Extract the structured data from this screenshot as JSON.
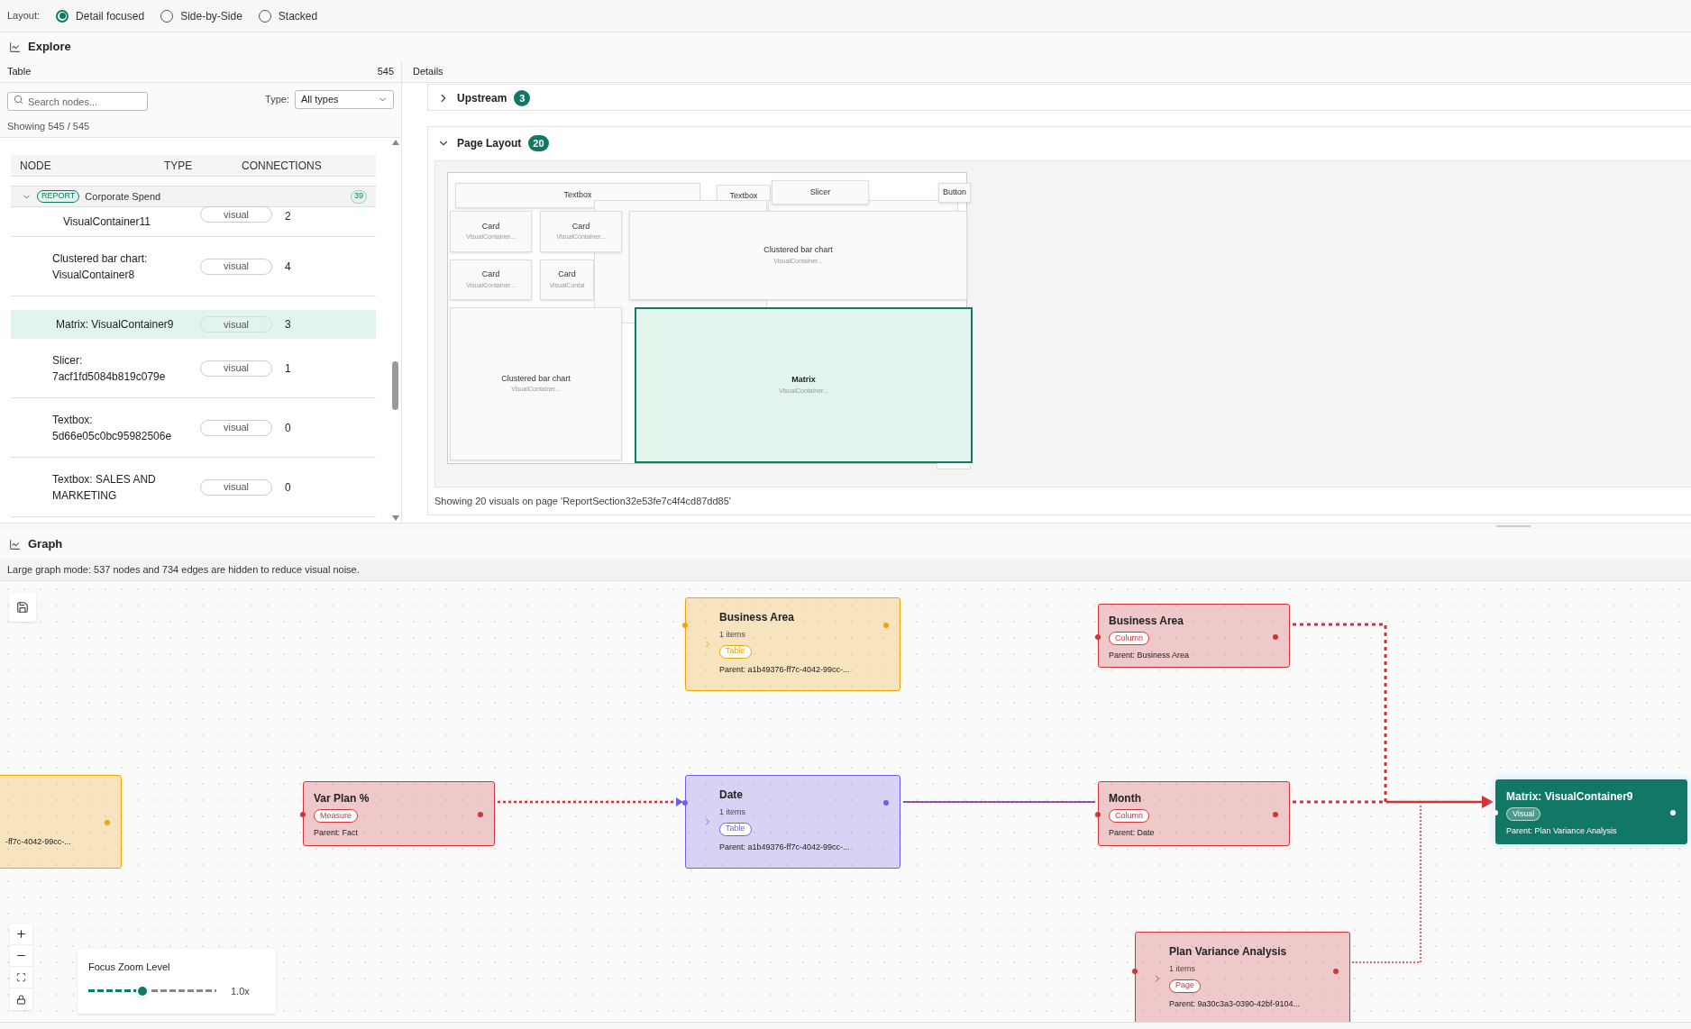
{
  "layout_bar": {
    "label": "Layout:",
    "options": [
      {
        "label": "Detail focused",
        "selected": true
      },
      {
        "label": "Side-by-Side",
        "selected": false
      },
      {
        "label": "Stacked",
        "selected": false
      }
    ]
  },
  "explore": {
    "title": "Explore",
    "table": {
      "title": "Table",
      "total": "545",
      "search": {
        "placeholder": "Search nodes..."
      },
      "type_label": "Type:",
      "type_value": "All types",
      "showing": "Showing 545 / 545",
      "columns": [
        "NODE",
        "TYPE",
        "CONNECTIONS"
      ],
      "group": {
        "badge": "REPORT",
        "name": "Corporate Spend",
        "count": "39",
        "expanded": true
      },
      "rows": [
        {
          "node": "VisualContainer11",
          "type": "visual",
          "connections": "2",
          "selected": false
        },
        {
          "node": "Clustered bar chart: VisualContainer8",
          "type": "visual",
          "connections": "4",
          "selected": false
        },
        {
          "node": "Matrix: VisualContainer9",
          "type": "visual",
          "connections": "3",
          "selected": true
        },
        {
          "node": "Slicer: 7acf1fd5084b819c079e",
          "type": "visual",
          "connections": "1",
          "selected": false
        },
        {
          "node": "Textbox: 5d66e05c0bc95982506e",
          "type": "visual",
          "connections": "0",
          "selected": false
        },
        {
          "node": "Textbox: SALES AND MARKETING",
          "type": "visual",
          "connections": "0",
          "selected": false
        }
      ]
    },
    "details": {
      "title": "Details",
      "sections": [
        {
          "title": "Upstream",
          "count": "3",
          "expanded": false
        },
        {
          "title": "Page Layout",
          "count": "20",
          "expanded": true
        }
      ],
      "visuals": [
        {
          "title": "Textbox",
          "selected": false
        },
        {
          "title": "Textbox",
          "selected": false
        },
        {
          "title": "Card",
          "subtitle": "VisualContai",
          "selected": false
        },
        {
          "title": "Slicer",
          "selected": false
        },
        {
          "title": "Button",
          "selected": false
        },
        {
          "title": "Card",
          "subtitle": "VisualContainer...",
          "selected": false
        },
        {
          "title": "Card",
          "subtitle": "VisualContainer...",
          "selected": false
        },
        {
          "title": "Card",
          "subtitle": "VisualContainer...",
          "selected": false
        },
        {
          "title": "Clustered bar chart",
          "subtitle": "VisualContainer...",
          "selected": false
        },
        {
          "title": "Clustered bar chart",
          "subtitle": "VisualContainer...",
          "selected": false
        },
        {
          "title": "Matrix",
          "subtitle": "VisualContainer...",
          "selected": true
        }
      ],
      "footer": "Showing 20 visuals on page 'ReportSection32e53fe7c4f4cd87dd85'"
    }
  },
  "graph": {
    "title": "Graph",
    "notice": "Large graph mode: 537 nodes and 734 edges are hidden to reduce visual noise.",
    "nodes": [
      {
        "title": "Business Area",
        "items": "1 items",
        "tag": "Table",
        "parent": "Parent: a1b49376-ff7c-4042-99cc-...",
        "color": "#f0a30a",
        "selected": false
      },
      {
        "title": "Business Area",
        "tag": "Column",
        "parent": "Parent: Business Area",
        "color": "#d13438",
        "selected": false
      },
      {
        "parent": "-ff7c-4042-99cc-...",
        "color": "#f0a30a",
        "selected": false
      },
      {
        "title": "Var Plan %",
        "tag": "Measure",
        "parent": "Parent: Fact",
        "color": "#d13438",
        "selected": false
      },
      {
        "title": "Date",
        "items": "1 items",
        "tag": "Table",
        "parent": "Parent: a1b49376-ff7c-4042-99cc-...",
        "color": "#7160e8",
        "selected": false
      },
      {
        "title": "Month",
        "tag": "Column",
        "parent": "Parent: Date",
        "color": "#d13438",
        "selected": false
      },
      {
        "title": "Matrix: VisualContainer9",
        "tag": "Visual",
        "parent": "Parent: Plan Variance Analysis",
        "color": "#117865",
        "selected": true
      },
      {
        "title": "Plan Variance Analysis",
        "items": "1 items",
        "tag": "Page",
        "parent": "Parent: 9a30c3a3-0390-42bf-9104...",
        "color": "#d13438",
        "selected": false
      }
    ],
    "zoom": {
      "title": "Focus Zoom Level",
      "level": 0.42,
      "reading": "1.0x"
    }
  }
}
